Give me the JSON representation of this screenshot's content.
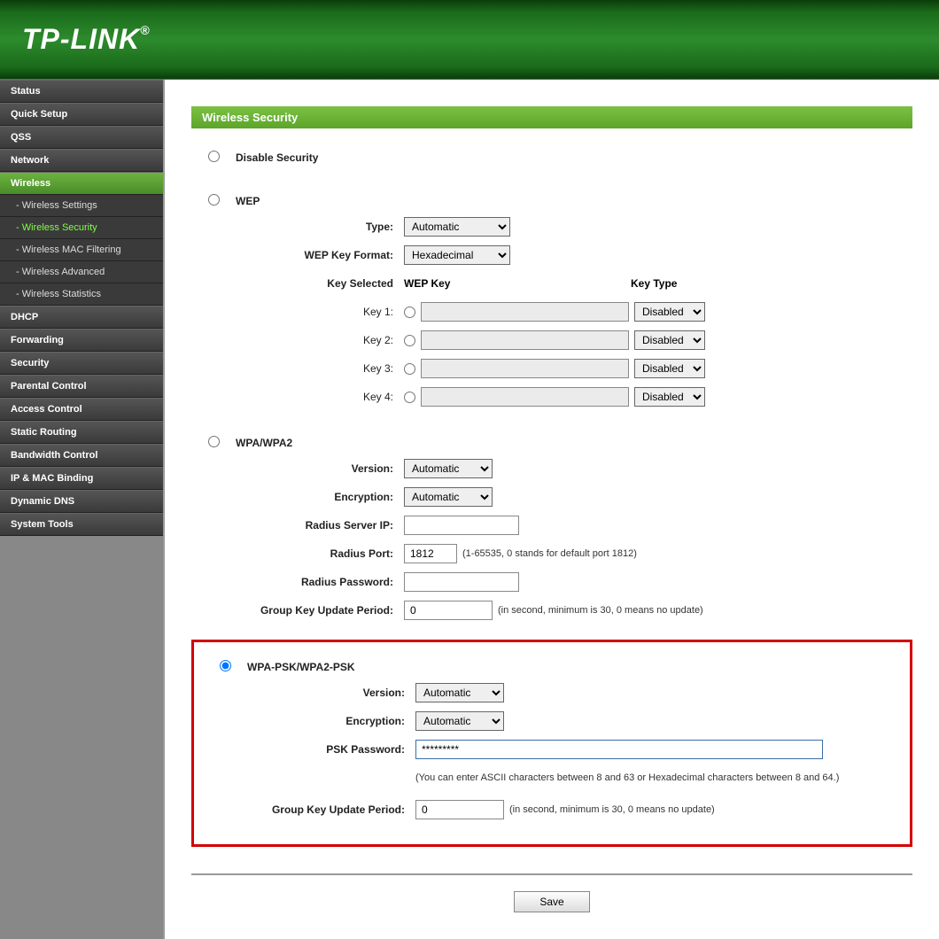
{
  "header": {
    "logo": "TP-LINK"
  },
  "sidebar": {
    "items": [
      {
        "label": "Status",
        "type": "top"
      },
      {
        "label": "Quick Setup",
        "type": "top"
      },
      {
        "label": "QSS",
        "type": "top"
      },
      {
        "label": "Network",
        "type": "top"
      },
      {
        "label": "Wireless",
        "type": "top",
        "active": true
      },
      {
        "label": "- Wireless Settings",
        "type": "sub"
      },
      {
        "label": "- Wireless Security",
        "type": "sub",
        "active": true
      },
      {
        "label": "- Wireless MAC Filtering",
        "type": "sub"
      },
      {
        "label": "- Wireless Advanced",
        "type": "sub"
      },
      {
        "label": "- Wireless Statistics",
        "type": "sub"
      },
      {
        "label": "DHCP",
        "type": "top"
      },
      {
        "label": "Forwarding",
        "type": "top"
      },
      {
        "label": "Security",
        "type": "top"
      },
      {
        "label": "Parental Control",
        "type": "top"
      },
      {
        "label": "Access Control",
        "type": "top"
      },
      {
        "label": "Static Routing",
        "type": "top"
      },
      {
        "label": "Bandwidth Control",
        "type": "top"
      },
      {
        "label": "IP & MAC Binding",
        "type": "top"
      },
      {
        "label": "Dynamic DNS",
        "type": "top"
      },
      {
        "label": "System Tools",
        "type": "top"
      }
    ]
  },
  "page": {
    "title": "Wireless Security"
  },
  "options": {
    "disable": {
      "label": "Disable Security"
    },
    "wep": {
      "label": "WEP",
      "type_label": "Type:",
      "type_value": "Automatic",
      "format_label": "WEP Key Format:",
      "format_value": "Hexadecimal",
      "key_selected_label": "Key Selected",
      "wep_key_header": "WEP Key",
      "key_type_header": "Key Type",
      "keys": [
        {
          "label": "Key 1:",
          "value": "",
          "type": "Disabled"
        },
        {
          "label": "Key 2:",
          "value": "",
          "type": "Disabled"
        },
        {
          "label": "Key 3:",
          "value": "",
          "type": "Disabled"
        },
        {
          "label": "Key 4:",
          "value": "",
          "type": "Disabled"
        }
      ]
    },
    "wpa": {
      "label": "WPA/WPA2",
      "version_label": "Version:",
      "version_value": "Automatic",
      "encryption_label": "Encryption:",
      "encryption_value": "Automatic",
      "radius_ip_label": "Radius Server IP:",
      "radius_ip_value": "",
      "radius_port_label": "Radius Port:",
      "radius_port_value": "1812",
      "radius_port_hint": "(1-65535, 0 stands for default port 1812)",
      "radius_pw_label": "Radius Password:",
      "radius_pw_value": "",
      "group_key_label": "Group Key Update Period:",
      "group_key_value": "0",
      "group_key_hint": "(in second, minimum is 30, 0 means no update)"
    },
    "psk": {
      "label": "WPA-PSK/WPA2-PSK",
      "version_label": "Version:",
      "version_value": "Automatic",
      "encryption_label": "Encryption:",
      "encryption_value": "Automatic",
      "password_label": "PSK Password:",
      "password_value": "*********",
      "password_hint": "(You can enter ASCII characters between 8 and 63 or Hexadecimal characters between 8 and 64.)",
      "group_key_label": "Group Key Update Period:",
      "group_key_value": "0",
      "group_key_hint": "(in second, minimum is 30, 0 means no update)"
    }
  },
  "buttons": {
    "save": "Save"
  }
}
